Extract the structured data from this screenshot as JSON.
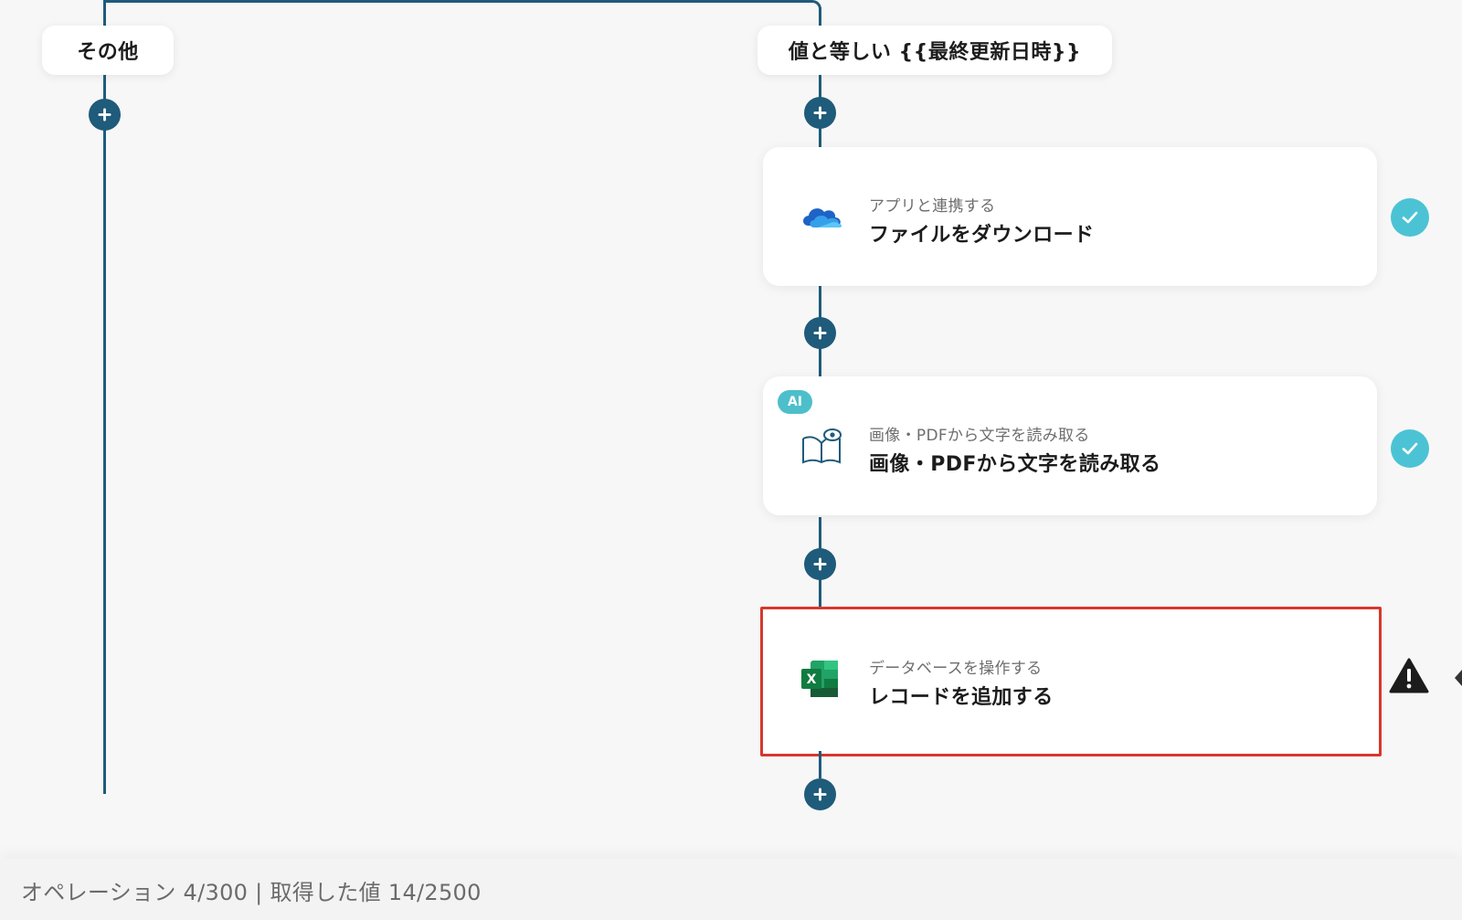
{
  "branches": {
    "left_label": "その他",
    "right_label": "値と等しい {{最終更新日時}}"
  },
  "steps": [
    {
      "subtitle": "アプリと連携する",
      "title": "ファイルをダウンロード",
      "icon": "onedrive-icon",
      "status": "success"
    },
    {
      "badge": "AI",
      "subtitle": "画像・PDFから文字を読み取る",
      "title": "画像・PDFから文字を読み取る",
      "icon": "book-eye-icon",
      "status": "success"
    },
    {
      "subtitle": "データベースを操作する",
      "title": "レコードを追加する",
      "icon": "excel-icon",
      "status": "warning"
    }
  ],
  "footer": {
    "text": "オペレーション 4/300 | 取得した値 14/2500"
  },
  "colors": {
    "connector": "#1f5b7a",
    "check": "#4cc3d4",
    "ai_badge": "#4dbfca",
    "selected_border": "#d6382c"
  }
}
